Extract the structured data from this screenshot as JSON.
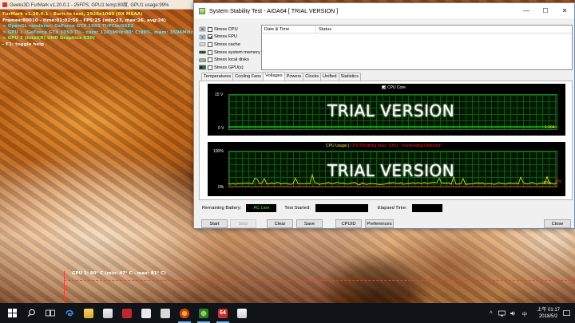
{
  "furmark": {
    "window_title": "Geeks3D FurMark v1.20.0.1 - 25FPS, GPU1 temp:80度, GPU1 usage:99%",
    "overlay": {
      "line1": "FurMark v1.20.0.1 - Burn-in test, 1920x1080 (0X MSAA)",
      "line2": "Frames:80010 - time:01:02:56 - FPS:25 (min:23, max:26, avg:24)",
      "line3": "> OpenGL renderer: GeForce GTX 1050 Ti/PCIe/SSE2",
      "line4": "> GPU 1 (GeForce GTX 1050 Ti) - core: 1101MHz:80° C:99%, mem: 3504MHz:6%, limits[power:1",
      "line5": "> GPU 2 (Intel(R) UHD Graphics 630)",
      "line6": "- F1: toggle help"
    },
    "graph_label": "GPU 1: 80° C (min: 47° C - max: 81° C)"
  },
  "aida": {
    "title": "System Stability Test - AIDA64  [ TRIAL VERSION ]",
    "window_buttons": {
      "minimize": "—",
      "maximize": "☐",
      "close": "✕"
    },
    "stress_options": [
      {
        "label": "Stress CPU",
        "checked": false,
        "icon": "cpu-icon"
      },
      {
        "label": "Stress FPU",
        "checked": true,
        "icon": "fpu-icon"
      },
      {
        "label": "Stress cache",
        "checked": false,
        "icon": "cache-icon"
      },
      {
        "label": "Stress system memory",
        "checked": false,
        "icon": "memory-icon"
      },
      {
        "label": "Stress local disks",
        "checked": false,
        "icon": "disk-icon"
      },
      {
        "label": "Stress GPU(s)",
        "checked": false,
        "icon": "gpu-icon"
      }
    ],
    "log_columns": {
      "date_time": "Date & Time",
      "status": "Status"
    },
    "tabs": [
      "Temperatures",
      "Cooling Fans",
      "Voltages",
      "Powers",
      "Clocks",
      "Unified",
      "Statistics"
    ],
    "active_tab": "Voltages",
    "graph1": {
      "legend": "CPU Core",
      "y_top": "15 V",
      "y_bottom": "0 V",
      "value": "1.164",
      "watermark": "TRIAL VERSION"
    },
    "graph2": {
      "legend_cpu": "CPU Usage",
      "legend_sep": "|",
      "legend_throttle": "CPU Throttling (max: 10%) - Overheating Detected!",
      "y_top": "100%",
      "y_bottom": "0%",
      "value_usage": "10%",
      "value_throttle": "0%",
      "watermark": "TRIAL VERSION"
    },
    "status": {
      "battery_label": "Remaining Battery:",
      "battery_value": "AC Line",
      "test_started_label": "Test Started:",
      "test_started_value": "",
      "elapsed_label": "Elapsed Time:",
      "elapsed_value": ""
    },
    "buttons": {
      "start": "Start",
      "stop": "Stop",
      "clear": "Clear",
      "save": "Save",
      "cpuid": "CPUID",
      "preferences": "Preferences",
      "close": "Close"
    }
  },
  "taskbar": {
    "apps": [
      "start-icon",
      "search-icon",
      "task-view-icon",
      "edge-icon",
      "file-explorer-icon",
      "store-icon",
      "app-grid-icon",
      "photos-icon",
      "settings-app-icon",
      "furmark-icon",
      "browser-icon",
      "aida64-icon",
      "photo-viewer-icon"
    ],
    "aida_tile_text": "64",
    "ime": "中",
    "time": "上午 01:17",
    "date": "2018/5/2"
  },
  "colors": {
    "graph_green": "#1a7a1a",
    "value_green": "#1fff1f",
    "throttle_red": "#ff2020",
    "usage_yellow": "#ffea00",
    "fm_cyan": "#49e7ff",
    "fm_yellow": "#f7ef3a"
  }
}
